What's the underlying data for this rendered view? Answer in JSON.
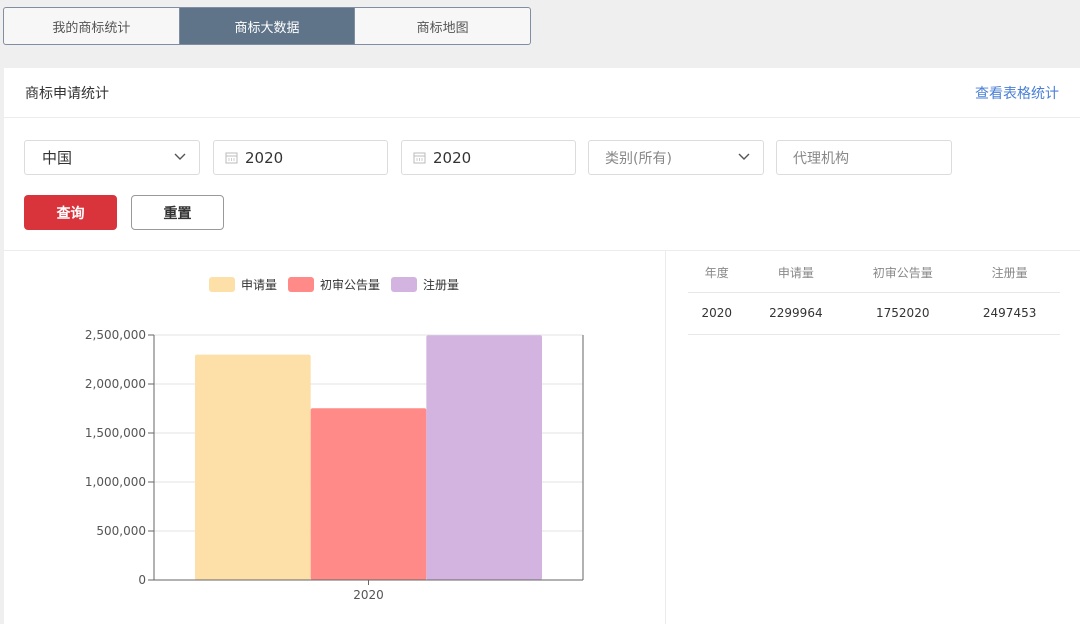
{
  "tabs": [
    {
      "label": "我的商标统计",
      "active": false
    },
    {
      "label": "商标大数据",
      "active": true
    },
    {
      "label": "商标地图",
      "active": false
    }
  ],
  "panel": {
    "title": "商标申请统计",
    "table_link": "查看表格统计"
  },
  "filters": {
    "region": "中国",
    "year_start": "2020",
    "year_end": "2020",
    "category_placeholder": "类别(所有)",
    "agency_placeholder": "代理机构"
  },
  "buttons": {
    "query": "查询",
    "reset": "重置"
  },
  "table": {
    "headers": [
      "年度",
      "申请量",
      "初审公告量",
      "注册量"
    ],
    "rows": [
      [
        "2020",
        "2299964",
        "1752020",
        "2497453"
      ]
    ]
  },
  "chart_data": {
    "type": "bar",
    "categories": [
      "2020"
    ],
    "series": [
      {
        "name": "申请量",
        "values": [
          2299964
        ],
        "color": "#fde0a8"
      },
      {
        "name": "初审公告量",
        "values": [
          1752020
        ],
        "color": "#ff8a87"
      },
      {
        "name": "注册量",
        "values": [
          2497453
        ],
        "color": "#d3b4e1"
      }
    ],
    "ylim": [
      0,
      2500000
    ],
    "yticks": [
      "0",
      "500,000",
      "1,000,000",
      "1,500,000",
      "2,000,000",
      "2,500,000"
    ],
    "legend_position": "top",
    "grid": true
  }
}
